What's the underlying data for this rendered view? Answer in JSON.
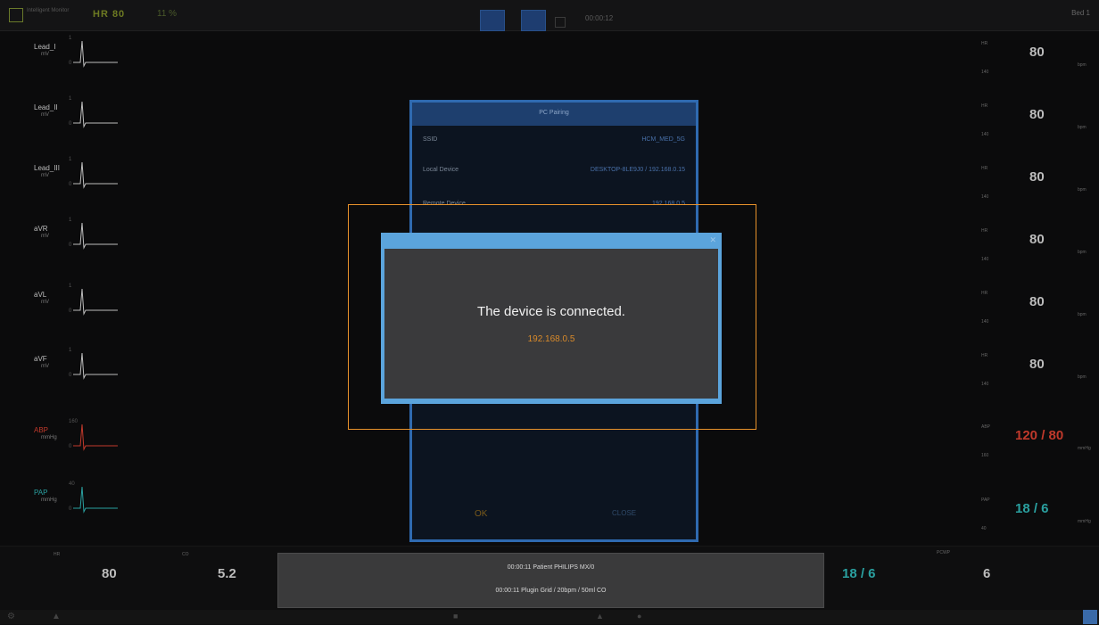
{
  "topbar": {
    "brand": "Intelligent Monitor",
    "hr_label": "HR 80",
    "mode_label": "11 %",
    "time_field": "00:00:12",
    "user_label": "Bed 1"
  },
  "leads": [
    {
      "label": "Lead_I",
      "unit": "mV",
      "ticks": [
        "1",
        "0"
      ]
    },
    {
      "label": "Lead_II",
      "unit": "mV",
      "ticks": [
        "1",
        "0"
      ]
    },
    {
      "label": "Lead_III",
      "unit": "mV",
      "ticks": [
        "1",
        "0"
      ]
    },
    {
      "label": "aVR",
      "unit": "mV",
      "ticks": [
        "1",
        "0"
      ]
    },
    {
      "label": "aVL",
      "unit": "mV",
      "ticks": [
        "1",
        "0"
      ]
    },
    {
      "label": "aVF",
      "unit": "mV",
      "ticks": [
        "1",
        "0"
      ]
    },
    {
      "label": "ABP",
      "unit": "mmHg",
      "ticks": [
        "160",
        "0"
      ]
    },
    {
      "label": "PAP",
      "unit": "mmHg",
      "ticks": [
        "40",
        "0"
      ]
    }
  ],
  "right_panel": [
    {
      "value": "80",
      "top": "HR",
      "bottom": "140",
      "unit": "bpm"
    },
    {
      "value": "80",
      "top": "HR",
      "bottom": "140",
      "unit": "bpm"
    },
    {
      "value": "80",
      "top": "HR",
      "bottom": "140",
      "unit": "bpm"
    },
    {
      "value": "80",
      "top": "HR",
      "bottom": "140",
      "unit": "bpm"
    },
    {
      "value": "80",
      "top": "HR",
      "bottom": "140",
      "unit": "bpm"
    },
    {
      "value": "80",
      "top": "HR",
      "bottom": "140",
      "unit": "bpm"
    },
    {
      "value": "120 / 80",
      "top": "ABP",
      "bottom": "160",
      "unit": "mmHg"
    },
    {
      "value": "18 / 6",
      "top": "PAP",
      "bottom": "40",
      "unit": "mmHg"
    }
  ],
  "bottom": {
    "hr_value": "80",
    "co_value": "5.2",
    "pap_value": "18 / 6",
    "pcwp_value": "6",
    "notice_line1": "00:00:11  Patient  PHILIPS MX/0",
    "notice_line2": "00:00:11  Plugin  Grid / 20bpm / 50ml CO"
  },
  "background_dialog": {
    "title": "PC Pairing",
    "rows": [
      {
        "label": "SSID",
        "value": "HCM_MED_5G"
      },
      {
        "label": "Local Device",
        "value": "DESKTOP-8LE9J0 / 192.168.0.15"
      },
      {
        "label": "Remote Device",
        "value": "192.168.0.5"
      }
    ],
    "ok_label": "OK",
    "cancel_label": "CLOSE"
  },
  "dialog": {
    "message": "The device is connected.",
    "ip_address": "192.168.0.5",
    "close_glyph": "✕"
  },
  "colors": {
    "dialog_border": "#5ba4dc",
    "dialog_body": "#3a3a3c",
    "highlight": "#e8922b",
    "ip_text": "#d98a2a",
    "abp_red": "#c0392b",
    "pap_teal": "#2aa0a0"
  }
}
